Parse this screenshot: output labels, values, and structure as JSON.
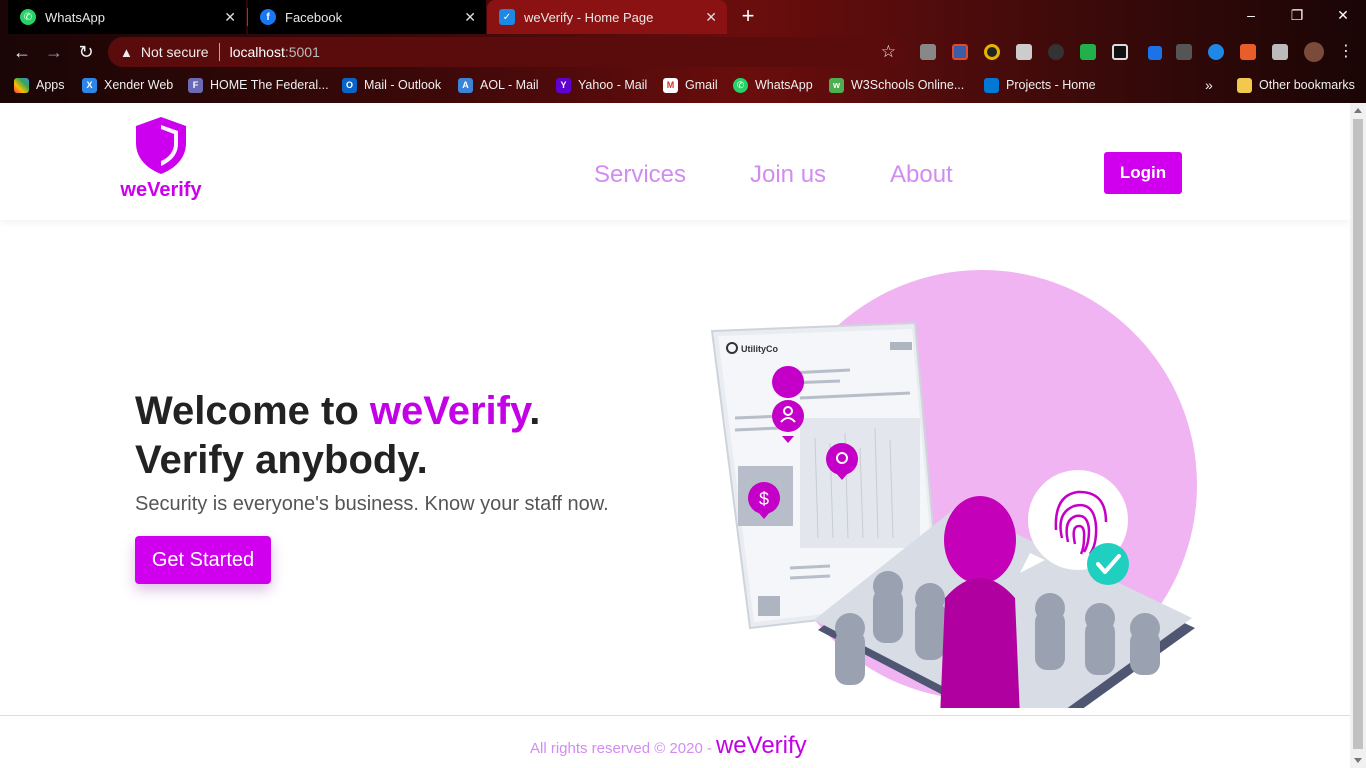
{
  "browser": {
    "tabs": [
      {
        "title": "WhatsApp",
        "icon": "whatsapp-icon",
        "active": false
      },
      {
        "title": "Facebook",
        "icon": "facebook-icon",
        "active": false
      },
      {
        "title": "weVerify - Home Page",
        "icon": "weverify-tab-icon",
        "active": true
      }
    ],
    "new_tab": "+",
    "window_controls": {
      "minimize": "–",
      "restore": "❐",
      "close": "✕"
    },
    "address": {
      "security": "Not secure",
      "host": "localhost",
      "port": ":5001"
    },
    "bookmarks": [
      {
        "label": "Apps",
        "icon": "apps-grid-icon"
      },
      {
        "label": "Xender Web",
        "icon": "xender-icon"
      },
      {
        "label": "HOME  The Federal...",
        "icon": "federal-icon"
      },
      {
        "label": "Mail - Outlook",
        "icon": "outlook-icon"
      },
      {
        "label": "AOL - Mail",
        "icon": "aol-icon"
      },
      {
        "label": "Yahoo - Mail",
        "icon": "yahoo-icon"
      },
      {
        "label": "Gmail",
        "icon": "gmail-icon"
      },
      {
        "label": "WhatsApp",
        "icon": "whatsapp-icon"
      },
      {
        "label": "W3Schools Online...",
        "icon": "w3schools-icon"
      },
      {
        "label": "Projects - Home",
        "icon": "azure-devops-icon"
      }
    ],
    "bookmarks_overflow": "»",
    "other_bookmarks": "Other bookmarks"
  },
  "site": {
    "brand": "weVerify",
    "nav": {
      "services": "Services",
      "join": "Join us",
      "about": "About",
      "login": "Login"
    },
    "hero": {
      "line1_prefix": "Welcome to ",
      "line1_accent": "weVerify",
      "line1_suffix": ".",
      "line2": "Verify anybody.",
      "subtitle": "Security is everyone's business. Know your staff now.",
      "cta": "Get Started"
    },
    "illustration": {
      "doc_label": "UtilityCo"
    },
    "footer": {
      "copyright": "All rights reserved © 2020 -",
      "brand": "weVerify"
    }
  },
  "colors": {
    "accent": "#d000ee",
    "accent_light": "#d28cf0",
    "circle": "#f0b4f2"
  }
}
